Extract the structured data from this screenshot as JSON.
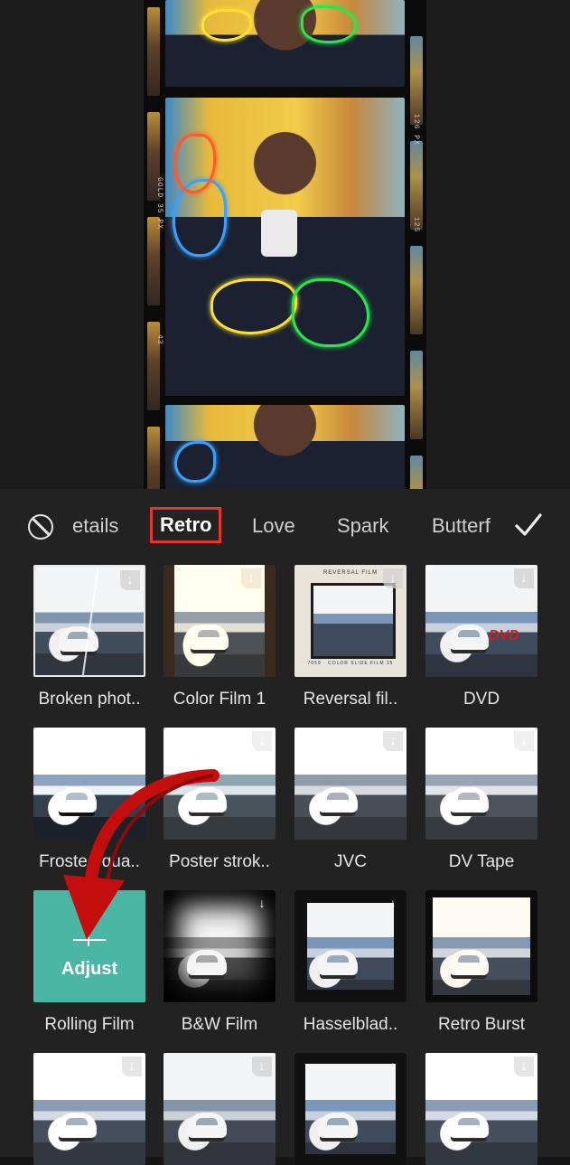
{
  "tabs": {
    "none_icon": "no-effect-icon",
    "items": [
      {
        "label": "etails",
        "active": false
      },
      {
        "label": "Retro",
        "active": true
      },
      {
        "label": "Love",
        "active": false
      },
      {
        "label": "Spark",
        "active": false
      },
      {
        "label": "Butterf",
        "active": false
      }
    ],
    "confirm_icon": "checkmark-icon"
  },
  "preview": {
    "film_edge_texts": [
      "126 PX",
      "GOLD 35 PX",
      "43",
      "125"
    ]
  },
  "effects": [
    {
      "label": "Broken phot..",
      "download": true
    },
    {
      "label": "Color Film 1",
      "download": true
    },
    {
      "label": "Reversal fil..",
      "download": true,
      "frame_caption": "REVERSAL FILM",
      "frame_footer": "7059 · COLOR SLIDE FILM 35"
    },
    {
      "label": "DVD",
      "download": true,
      "badge": "DVD"
    },
    {
      "label": "Frosted qua..",
      "download": true
    },
    {
      "label": "Poster strok..",
      "download": true
    },
    {
      "label": "JVC",
      "download": true
    },
    {
      "label": "DV Tape",
      "download": true
    },
    {
      "label": "Rolling Film",
      "download": false,
      "overlay": "Adjust"
    },
    {
      "label": "B&W Film",
      "download": true
    },
    {
      "label": "Hasselblad..",
      "download": true
    },
    {
      "label": "Retro Burst",
      "download": true
    },
    {
      "label": "",
      "download": true
    },
    {
      "label": "",
      "download": true
    },
    {
      "label": "",
      "download": true
    },
    {
      "label": "",
      "download": true
    }
  ],
  "colors": {
    "accent_highlight": "#e5352d",
    "annotation_arrow": "#c40d0d",
    "adjust_tile": "#49b7a4",
    "dvd_logo": "#d41b1b"
  }
}
